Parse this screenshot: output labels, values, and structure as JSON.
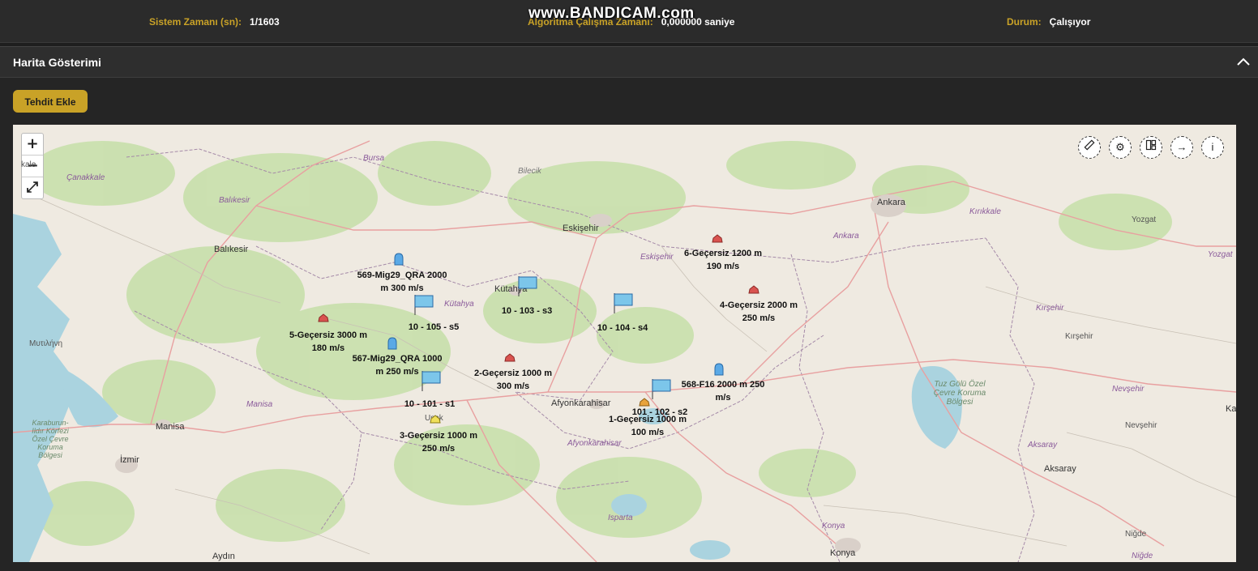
{
  "status": {
    "system_time_label": "Sistem Zamanı (sn):",
    "system_time_value": "1/1603",
    "algo_time_label": "Algoritma Çalışma Zamanı:",
    "algo_time_value": "0,000000 saniye",
    "state_label": "Durum:",
    "state_value": "Çalışıyor"
  },
  "watermark": "www.BANDICAM.com",
  "panel": {
    "title": "Harita Gösterimi",
    "add_threat_button": "Tehdit Ekle"
  },
  "map": {
    "zoom_in": "+",
    "zoom_out": "−",
    "fullscreen": "⤢",
    "tools": [
      "ruler-icon",
      "settings-icon",
      "layers-icon",
      "arrow-right-icon",
      "info-icon"
    ],
    "places": {
      "canakkale": "Çanakkale",
      "bursa": "Bursa",
      "bilecik": "Bilecik",
      "balikesir_prov": "Balıkesir",
      "balikesir": "Balıkesir",
      "eskisehir": "Eskişehir",
      "eskisehir_prov": "Eskişehir",
      "kutahya": "Kütahya",
      "kutahya_prov": "Kütahya",
      "ankara": "Ankara",
      "ankara_prov": "Ankara",
      "kirikkale": "Kırıkkale",
      "yozgat": "Yozgat",
      "yozgat_prov": "Yozgat",
      "kirsehir_prov": "Kırşehir",
      "kirsehir": "Kırşehir",
      "nevsehir_prov": "Nevşehir",
      "nevsehir": "Nevşehir",
      "mytilene": "Μυτιλήνη",
      "manisa_prov": "Manisa",
      "manisa": "Manisa",
      "izmir": "İzmir",
      "afyon": "Afyonkarahisar",
      "afyon_prov": "Afyonkarahisar",
      "tuzgolu": "Tuz Gölü Özel Çevre Koruma Bölgesi",
      "karaburun": "Karaburun-Ildır Körfezi Özel Çevre Koruma Bölgesi",
      "aksaray_prov": "Aksaray",
      "aksaray": "Aksaray",
      "aydin": "Aydın",
      "isparta": "Isparta",
      "konya_prov": "Konya",
      "konya": "Konya",
      "nigde_prov": "Niğde",
      "nigde": "Niğde",
      "ka": "Ka",
      "usak": "Uşak",
      "kale": "kale"
    },
    "labels": {
      "t1": [
        "1-Geçersiz 1000 m",
        "100 m/s"
      ],
      "t2": [
        "2-Geçersiz 1000 m",
        "300 m/s"
      ],
      "t3": [
        "3-Geçersiz 1000 m",
        "250 m/s"
      ],
      "t4": [
        "4-Geçersiz 2000 m",
        "250 m/s"
      ],
      "t5": [
        "5-Geçersiz 3000 m",
        "180 m/s"
      ],
      "t6": [
        "6-Geçersiz 1200 m",
        "190 m/s"
      ],
      "f567": [
        "567-Mig29_QRA 1000",
        "m 250 m/s"
      ],
      "f568": [
        "568-F16 2000 m 250",
        "m/s"
      ],
      "f569": [
        "569-Mig29_QRA 2000",
        "m 300 m/s"
      ],
      "s101": "10 - 101 - s1",
      "s102": "101 - 102 - s2",
      "s103": "10 - 103 - s3",
      "s104": "10 - 104 - s4",
      "s105": "10 - 105 - s5"
    },
    "colors": {
      "land": "#efeae1",
      "forest": "#c5dfa8",
      "water": "#aad3df",
      "threat_red": "#d9534f",
      "threat_orange": "#e8a33c",
      "threat_yellow": "#f0e05a",
      "aircraft_blue": "#5aa9e6",
      "site_blue": "#7cc6ea"
    }
  }
}
